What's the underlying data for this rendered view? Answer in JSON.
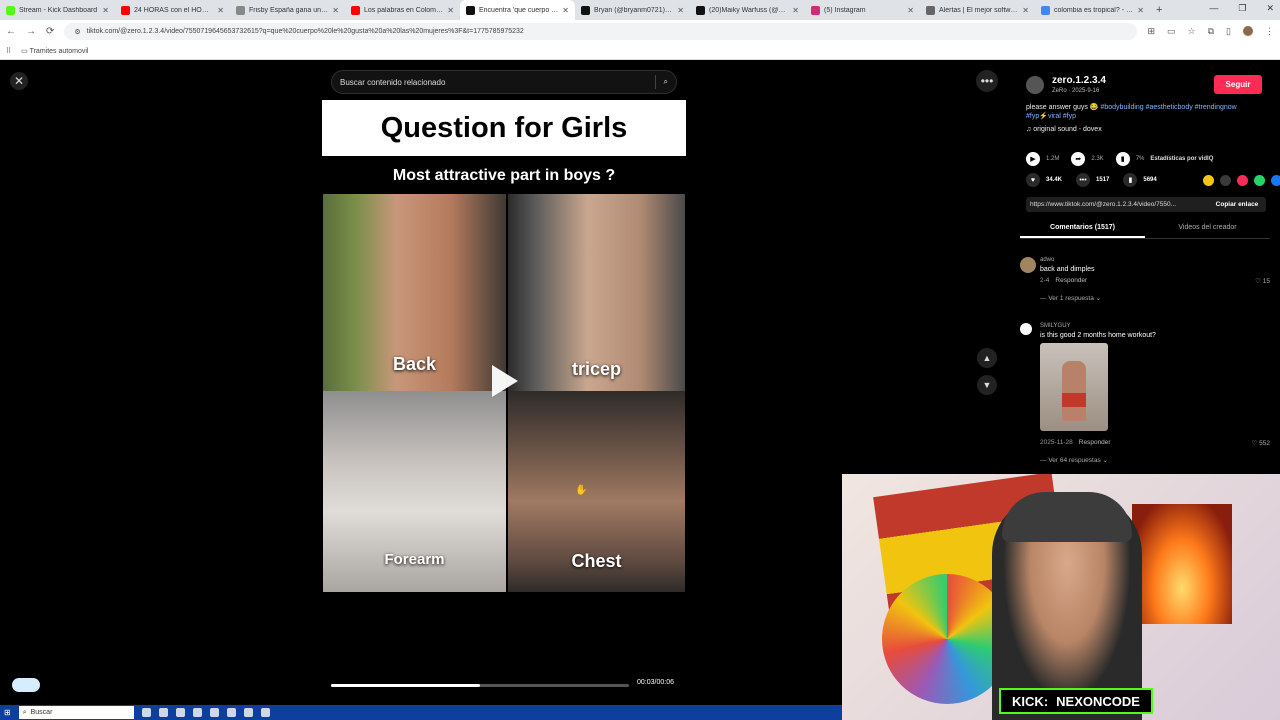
{
  "browser": {
    "tabs": [
      {
        "title": "Stream - Kick Dashboard",
        "color": "#53fc18"
      },
      {
        "title": "24 HORAS con el HOMBRE M",
        "color": "#ff0000"
      },
      {
        "title": "Frisby España gana una batal",
        "color": "#888888"
      },
      {
        "title": "Los palabras en Colombia no",
        "color": "#ff0000"
      },
      {
        "title": "Encuentra 'que cuerpo le gus",
        "color": "#111111",
        "active": true
      },
      {
        "title": "Bryan (@bryanm0721) | TikTo",
        "color": "#111111"
      },
      {
        "title": "(20)Maiky Warfuss (@maikym",
        "color": "#111111"
      },
      {
        "title": "(5) Instagram",
        "color": "#d62976"
      },
      {
        "title": "Alertas | El mejor software pa",
        "color": "#666666"
      },
      {
        "title": "colombia es tropical? - Buscar",
        "color": "#4285f4"
      }
    ],
    "url": "tiktok.com/@zero.1.2.3.4/video/7550719645653732615?q=que%20cuerpo%20le%20gusta%20a%20las%20mujeres%3F&t=1775785975232",
    "bookmark": "Tramites automovil"
  },
  "search": {
    "placeholder": "Buscar contenido relacionado"
  },
  "video": {
    "title": "Question for Girls",
    "subtitle": "Most attractive part in boys ?",
    "labels": [
      "Back",
      "tricep",
      "Forearm",
      "Chest"
    ],
    "progress": 0.5,
    "timecode": "00:03/00:06"
  },
  "author": {
    "name": "zero.1.2.3.4",
    "sub": "ZeRo · 2025-9-16",
    "follow": "Seguir",
    "desc_text": "please answer guys 😂 ",
    "desc_tags": "#bodybuilding #aestheticbody #trendingnow #fyp⚡viral #fyp",
    "sound": "original sound - dovex"
  },
  "stats": {
    "plays": "1.2M",
    "shares_a": "2.3K",
    "views_pct": "7%",
    "analytics": "Estadísticas por vidIQ",
    "likes": "34.4K",
    "comments": "1517",
    "saves": "5694"
  },
  "link": {
    "url": "https://www.tiktok.com/@zero.1.2.3.4/video/7550...",
    "copy": "Copiar enlace"
  },
  "panel_tabs": {
    "comments": "Comentarios (1517)",
    "videos": "Videos del creador"
  },
  "comments": [
    {
      "user": "adwo",
      "text": "back and dimples",
      "meta": "2-4",
      "reply": "Responder",
      "likes": "15",
      "replies": "Ver 1 respuesta"
    },
    {
      "user": "SMILYGUY",
      "text": "is this good 2 months home workout?",
      "meta": "2025-11-28",
      "reply": "Responder",
      "likes": "552",
      "replies": "Ver 64 respuestas"
    }
  ],
  "webcam": {
    "brand": "KICK:",
    "channel": "NEXONCODE"
  },
  "taskbar": {
    "search": "Buscar"
  },
  "colors": {
    "accent": "#fe2c55",
    "kick": "#53fc18",
    "taskbar": "#0f3f9e"
  }
}
